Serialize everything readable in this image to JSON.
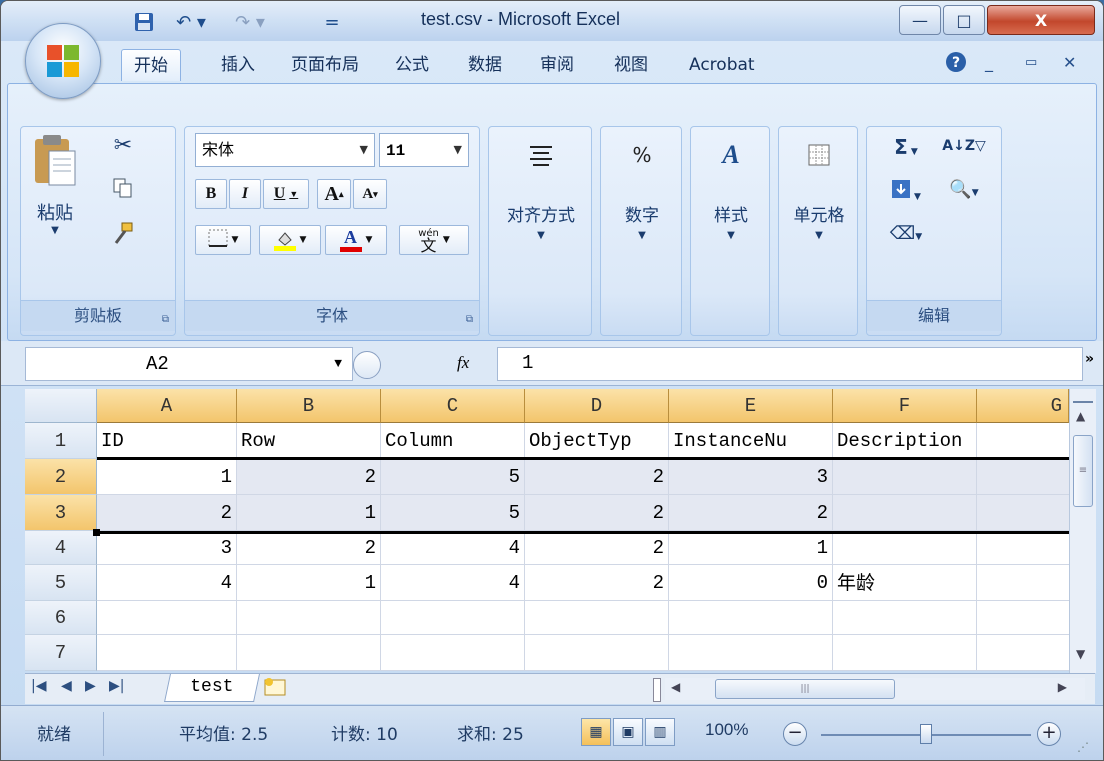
{
  "window": {
    "title": "test.csv - Microsoft Excel",
    "minimize": "—",
    "maximize": "□",
    "close": "X"
  },
  "quick_access": {
    "save": "💾",
    "undo": "↶ ▾",
    "redo": "↷ ▾",
    "customize": "="
  },
  "tabs": [
    {
      "label": "开始",
      "active": true
    },
    {
      "label": "插入"
    },
    {
      "label": "页面布局"
    },
    {
      "label": "公式"
    },
    {
      "label": "数据"
    },
    {
      "label": "审阅"
    },
    {
      "label": "视图"
    },
    {
      "label": "Acrobat"
    }
  ],
  "ribbon": {
    "clipboard": {
      "paste_label": "粘贴",
      "group_label": "剪贴板"
    },
    "font": {
      "font_name": "宋体",
      "font_size": "11",
      "bold": "B",
      "italic": "I",
      "underline": "U",
      "grow": "A",
      "shrink": "A",
      "wen": "wén",
      "group_label": "字体"
    },
    "alignment": {
      "label": "对齐方式"
    },
    "number": {
      "label": "数字",
      "icon_text": "%"
    },
    "styles": {
      "label": "样式"
    },
    "cells": {
      "label": "单元格"
    },
    "editing": {
      "group_label": "编辑",
      "sum": "Σ"
    }
  },
  "formula_bar": {
    "name_box": "A2",
    "fx": "fx",
    "value": "1"
  },
  "sheet": {
    "columns": [
      "A",
      "B",
      "C",
      "D",
      "E",
      "F",
      "G"
    ],
    "rows": [
      {
        "num": "1",
        "cells": [
          "ID",
          "Row",
          "Column",
          "ObjectTyp",
          "InstanceNu",
          "Description",
          ""
        ]
      },
      {
        "num": "2",
        "cells": [
          "1",
          "2",
          "5",
          "2",
          "3",
          "",
          ""
        ]
      },
      {
        "num": "3",
        "cells": [
          "2",
          "1",
          "5",
          "2",
          "2",
          "",
          ""
        ]
      },
      {
        "num": "4",
        "cells": [
          "3",
          "2",
          "4",
          "2",
          "1",
          "",
          ""
        ]
      },
      {
        "num": "5",
        "cells": [
          "4",
          "1",
          "4",
          "2",
          "0",
          "年龄",
          ""
        ]
      },
      {
        "num": "6",
        "cells": [
          "",
          "",
          "",
          "",
          "",
          "",
          ""
        ]
      },
      {
        "num": "7",
        "cells": [
          "",
          "",
          "",
          "",
          "",
          "",
          ""
        ]
      }
    ],
    "selected_rows": [
      2,
      3
    ],
    "active_tab": "test"
  },
  "status": {
    "ready": "就绪",
    "average": "平均值: 2.5",
    "count": "计数: 10",
    "sum": "求和: 25",
    "zoom": "100%",
    "zoom_level": 1.0
  },
  "colors": {
    "accent": "#1e4d8c",
    "selected_header": "#f3c56c",
    "font_highlight": "#ffff00",
    "font_color": "#e00000"
  }
}
